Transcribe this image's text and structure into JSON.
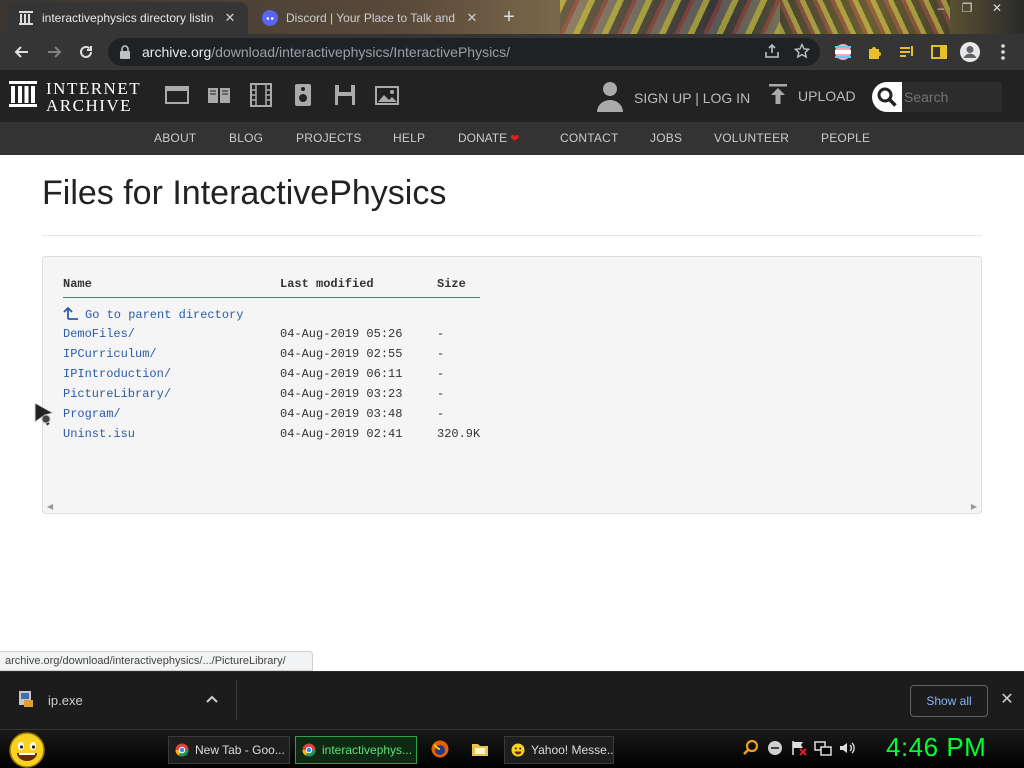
{
  "browser": {
    "tabs": [
      {
        "title": "interactivephysics directory listing",
        "active": true
      },
      {
        "title": "Discord | Your Place to Talk and",
        "active": false
      }
    ],
    "address": {
      "host": "archive.org",
      "path": "/download/interactivephysics/InteractivePhysics/"
    }
  },
  "ia_header": {
    "logo_line1": "INTERNET",
    "logo_line2": "ARCHIVE",
    "auth_label": "SIGN UP | LOG IN",
    "upload_label": "UPLOAD",
    "search_placeholder": "Search",
    "nav": [
      "ABOUT",
      "BLOG",
      "PROJECTS",
      "HELP",
      "DONATE",
      "CONTACT",
      "JOBS",
      "VOLUNTEER",
      "PEOPLE"
    ],
    "donate_heart_color": "#e02020"
  },
  "main": {
    "title": "Files for InteractivePhysics",
    "listing": {
      "columns": [
        "Name",
        "Last modified",
        "Size"
      ],
      "parent_label": "Go to parent directory",
      "rows": [
        {
          "name": "DemoFiles/",
          "modified": "04-Aug-2019 05:26",
          "size": "-"
        },
        {
          "name": "IPCurriculum/",
          "modified": "04-Aug-2019 02:55",
          "size": "-"
        },
        {
          "name": "IPIntroduction/",
          "modified": "04-Aug-2019 06:11",
          "size": "-"
        },
        {
          "name": "PictureLibrary/",
          "modified": "04-Aug-2019 03:23",
          "size": "-"
        },
        {
          "name": "Program/",
          "modified": "04-Aug-2019 03:48",
          "size": "-"
        },
        {
          "name": "Uninst.isu",
          "modified": "04-Aug-2019 02:41",
          "size": "320.9K"
        }
      ]
    }
  },
  "status_url": "archive.org/download/interactivephysics/.../PictureLibrary/",
  "download_shelf": {
    "file_name": "ip.exe",
    "show_all_label": "Show all"
  },
  "taskbar": {
    "buttons": [
      {
        "label": "New Tab - Goo...",
        "active": false
      },
      {
        "label": "interactivephys...",
        "active": true
      },
      {
        "label": "Yahoo! Messe...",
        "active": false
      }
    ],
    "clock": "4:46 PM"
  },
  "colors": {
    "link": "#2a5ca8",
    "header_bg": "#222222",
    "nav_bg": "#333333",
    "clock": "#00ff33"
  }
}
